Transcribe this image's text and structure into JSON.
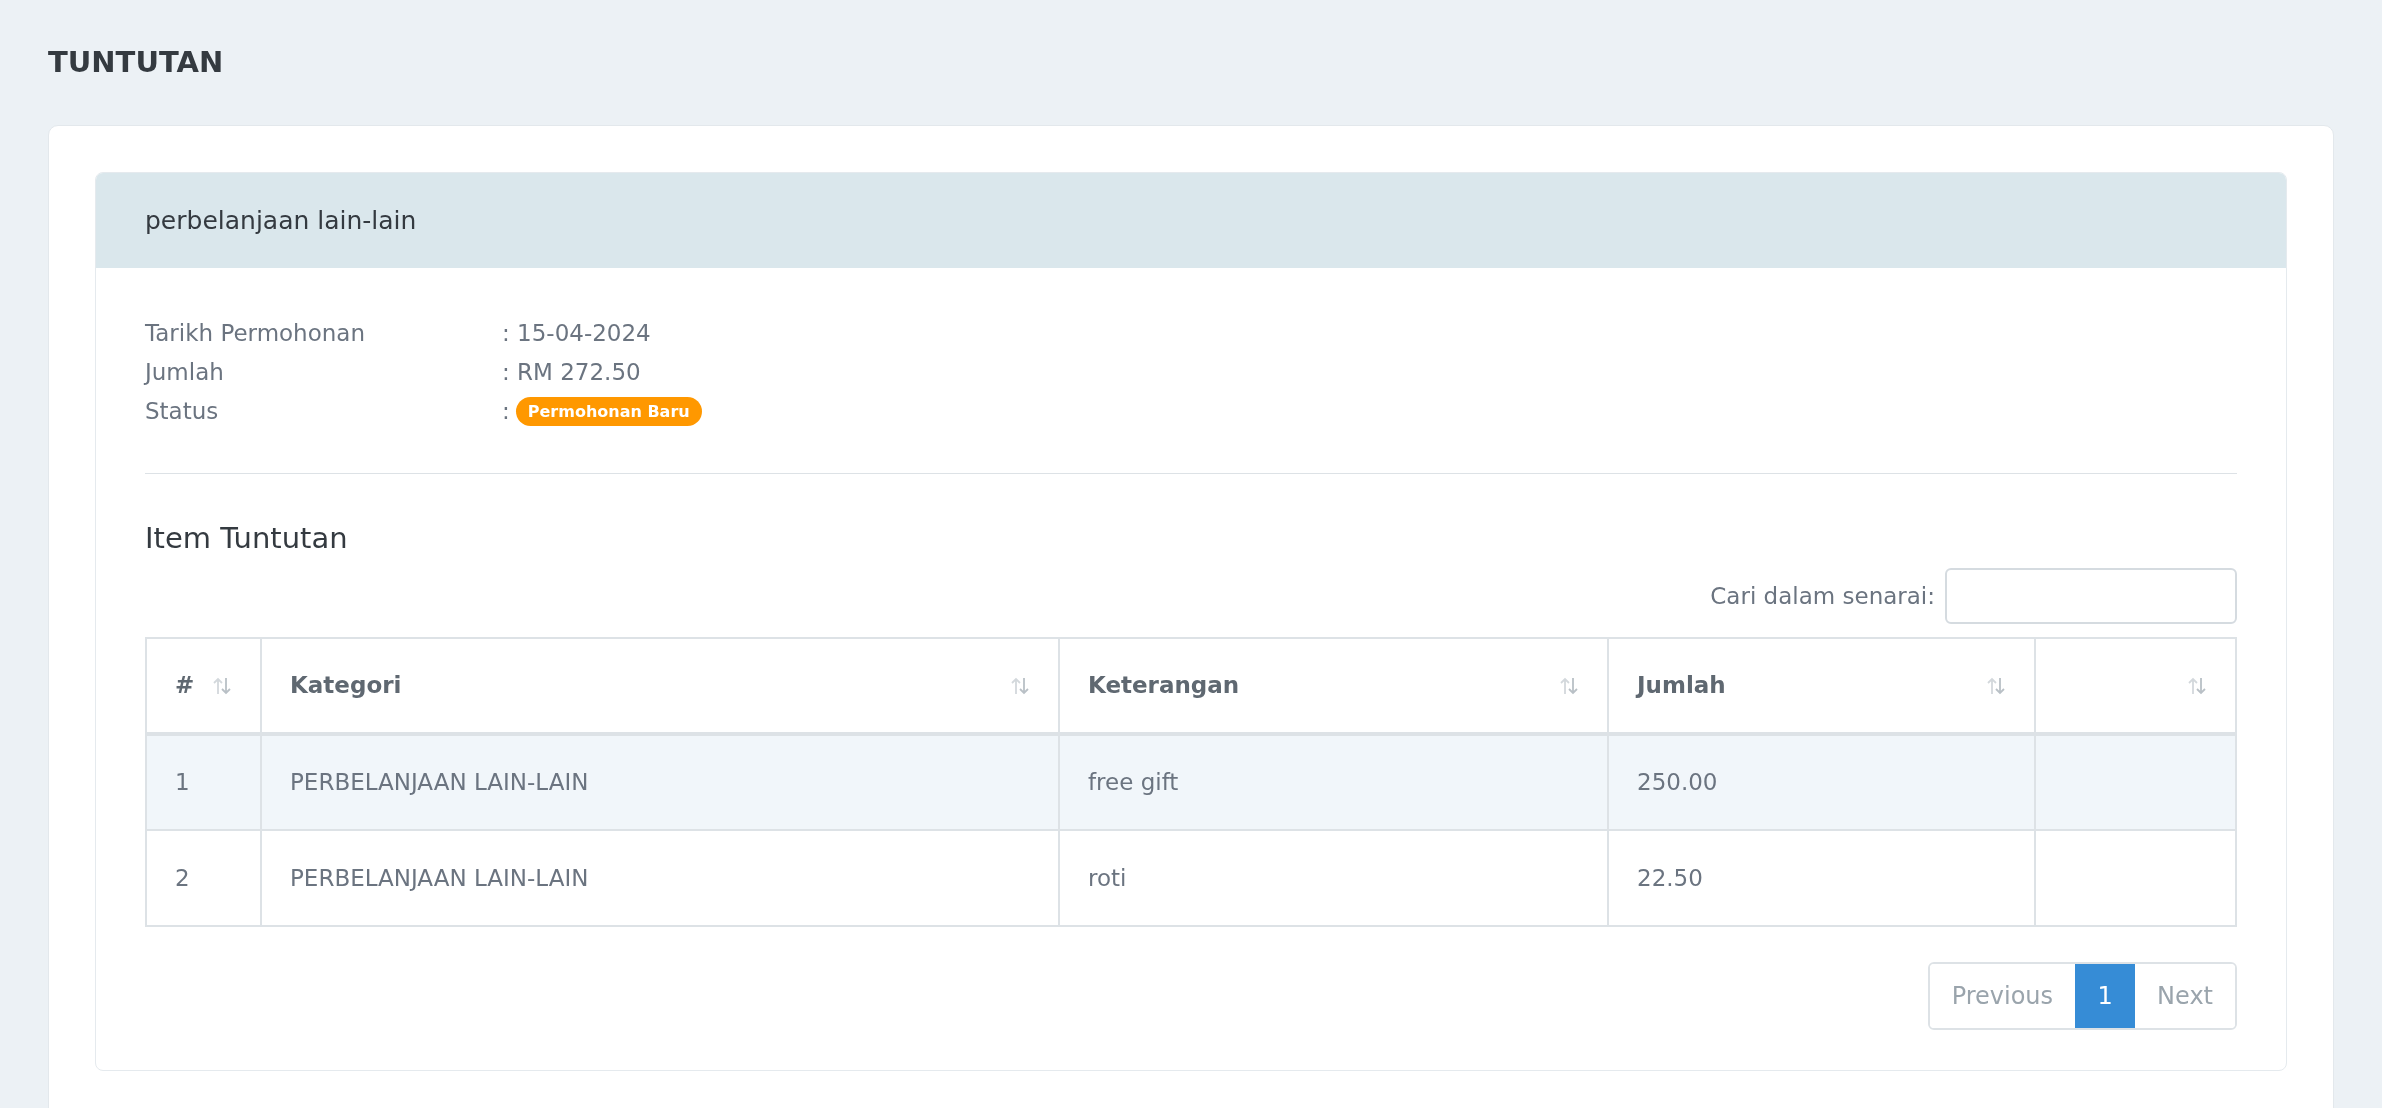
{
  "page_title": "TUNTUTAN",
  "claim": {
    "title": "perbelanjaan lain-lain",
    "details": [
      {
        "label": "Tarikh Permohonan",
        "kind": "text",
        "value": ": 15-04-2024"
      },
      {
        "label": "Jumlah",
        "kind": "text",
        "value": ": RM 272.50"
      },
      {
        "label": "Status",
        "kind": "badge",
        "prefix": ":",
        "value": "Permohonan Baru",
        "color": "#ff9800"
      }
    ]
  },
  "items": {
    "heading": "Item Tuntutan",
    "search": {
      "label": "Cari dalam senarai:"
    },
    "table": {
      "columns": [
        "#",
        "Kategori",
        "Keterangan",
        "Jumlah"
      ],
      "rows": [
        [
          "1",
          "PERBELANJAAN LAIN-LAIN",
          "free gift",
          "250.00"
        ],
        [
          "2",
          "PERBELANJAAN LAIN-LAIN",
          "roti",
          "22.50"
        ]
      ]
    },
    "pagination": {
      "previous": "Previous",
      "pages": [
        {
          "label": "1",
          "selected": true
        }
      ],
      "next": "Next"
    }
  }
}
